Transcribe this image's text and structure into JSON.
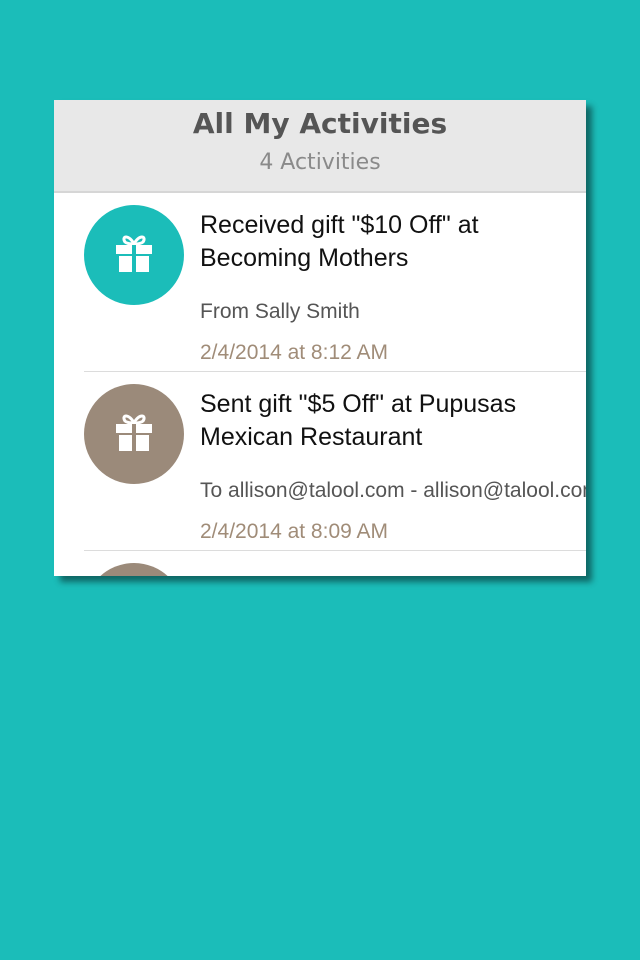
{
  "header": {
    "title": "All My Activities",
    "subtitle": "4 Activities"
  },
  "activities": [
    {
      "title_line1": "Received gift \"$10 Off\" at",
      "title_line2": "Becoming Mothers",
      "detail": "From Sally Smith",
      "timestamp": "2/4/2014 at 8:12 AM",
      "icon": "gift-icon",
      "icon_color": "#1bbdb9"
    },
    {
      "title_line1": "Sent gift \"$5 Off\" at Pupusas",
      "title_line2": "Mexican Restaurant",
      "detail": "To  allison@talool.com - allison@talool.com",
      "timestamp": "2/4/2014 at 8:09 AM",
      "icon": "gift-icon",
      "icon_color": "#9b8a7a"
    },
    {
      "icon": "gift-icon",
      "icon_color": "#9b8a7a"
    }
  ],
  "colors": {
    "background": "#1bbdb9",
    "teal_accent": "#1bbdb9",
    "brown_accent": "#9b8a7a",
    "timestamp": "#a08c78"
  }
}
